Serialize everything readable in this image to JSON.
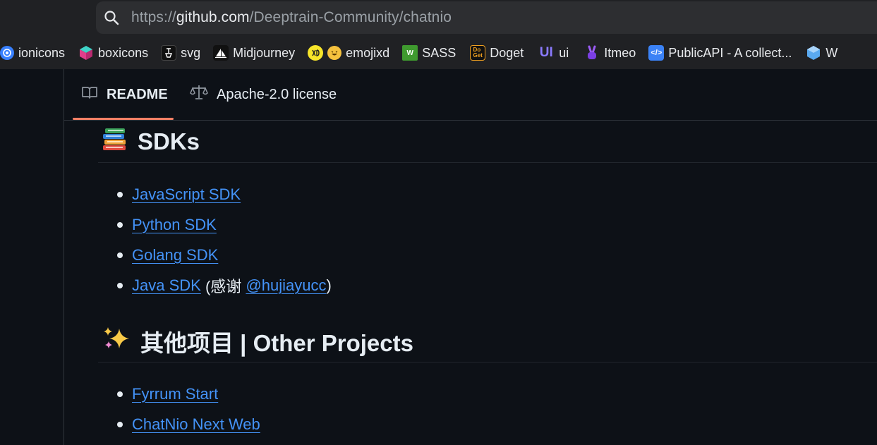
{
  "browser": {
    "url_prefix": "https://",
    "url_host": "github.com",
    "url_path": "/Deeptrain-Community/chatnio"
  },
  "bookmarks": [
    {
      "label": "ionicons",
      "icon": "ionicons-icon",
      "color": "#3880ff"
    },
    {
      "label": "boxicons",
      "icon": "boxicons-icon",
      "color": "#e03e8b"
    },
    {
      "label": "svg",
      "icon": "svg-icon",
      "color": "#111111"
    },
    {
      "label": "Midjourney",
      "icon": "midjourney-icon",
      "color": "#111111"
    },
    {
      "label": "emojixd",
      "icon": "emojixd-icon",
      "color": "#f7e52a"
    },
    {
      "label": "SASS",
      "icon": "sass-icon",
      "color": "#3f9a2f"
    },
    {
      "label": "Doget",
      "icon": "doget-icon",
      "color": "#f0a020"
    },
    {
      "label": "ui",
      "icon": "ui-icon",
      "color": "#7a5af8"
    },
    {
      "label": "Itmeo",
      "icon": "itmeo-icon",
      "color": "#7b3fe4"
    },
    {
      "label": "PublicAPI - A collect...",
      "icon": "publicapi-icon",
      "color": "#3b82f6"
    },
    {
      "label": "W",
      "icon": "w-icon",
      "color": "#5aa9f0"
    }
  ],
  "tabs": {
    "readme": "README",
    "license": "Apache-2.0 license"
  },
  "sdk_section": {
    "title": "SDKs",
    "items": [
      {
        "link": "JavaScript SDK"
      },
      {
        "link": "Python SDK"
      },
      {
        "link": "Golang SDK"
      },
      {
        "link": "Java SDK",
        "suffix_before": " (感谢 ",
        "mention": "@hujiayucc",
        "suffix_after": ")"
      }
    ]
  },
  "other_section": {
    "title": "其他项目 | Other Projects",
    "items": [
      {
        "link": "Fyrrum Start"
      },
      {
        "link": "ChatNio Next Web"
      }
    ]
  },
  "colors": {
    "background": "#0d1117",
    "link": "#4493f8",
    "tab_underline": "#f78166",
    "border": "#30363d"
  }
}
